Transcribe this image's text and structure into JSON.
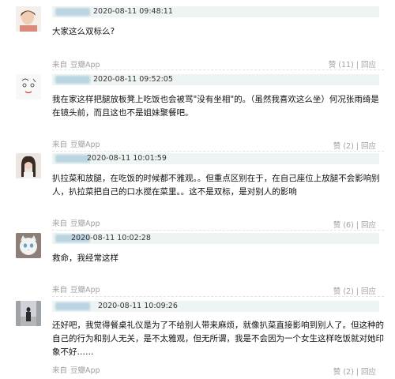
{
  "comments": [
    {
      "avatar": "avatar-child-photo",
      "time": "2020-08-11 09:48:11",
      "text": "大家这么双标么?",
      "source_label": "来自",
      "app": "豆瓣App",
      "like_label": "赞",
      "like_count": "(11)",
      "more_label": "回应"
    },
    {
      "avatar": "avatar-sketch",
      "time": "2020-08-11 09:52:05",
      "text": "我在家这样把腿放板凳上吃饭也会被骂\"没有坐相\"的。（虽然我喜欢这么坐）何况张雨绮是在镜头前，而且这也不是姐妹聚餐吧。",
      "source_label": "来自",
      "app": "豆瓣App",
      "like_label": "赞",
      "like_count": "(2)",
      "more_label": "回应"
    },
    {
      "avatar": "avatar-girl-photo",
      "time": "2020-08-11 10:01:59",
      "text": "扒拉菜和放腿，在吃饭的时候都不雅观。。但重点区别在于，在自己座位上放腿不会影响别人，扒拉菜把自己的口水搅在菜里。。这不是双标，是对别人的影响",
      "source_label": "来自",
      "app": "豆瓣App",
      "like_label": "赞",
      "like_count": "(6)",
      "more_label": "回应"
    },
    {
      "avatar": "avatar-cat-photo",
      "time": "2020-08-11 10:02:28",
      "text": "救命，我经常这样",
      "source_label": "来自",
      "app": "豆瓣App",
      "like_label": "赞",
      "like_count": "(2)",
      "more_label": "回应"
    },
    {
      "avatar": "avatar-street-photo",
      "time": "2020-08-11 10:09:26",
      "text": "还好吧，我觉得餐桌礼仪是为了不给别人带来麻烦，就像扒菜直接影响到别人了。但这种的自己的行为和别人无关，是不太雅观，但无所谓，我是不会因为一个女生这样吃饭就对她印象不好……",
      "source_label": "来自",
      "app": "豆瓣App",
      "like_label": "赞",
      "like_count": "(2)",
      "more_label": "回应"
    }
  ]
}
